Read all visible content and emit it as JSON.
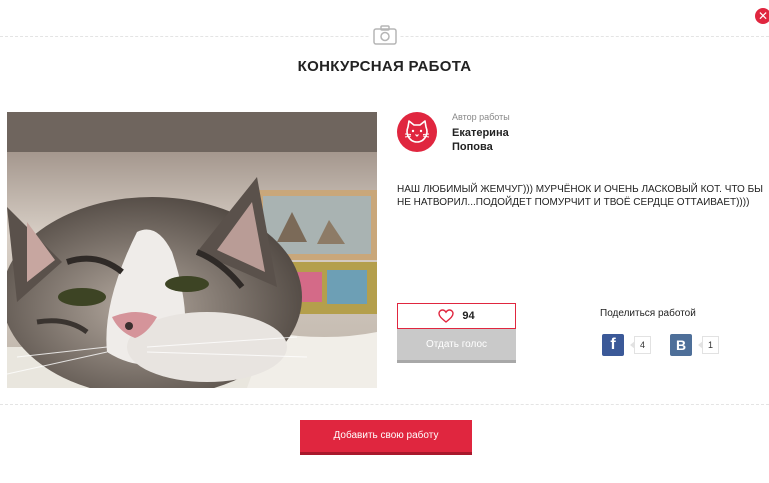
{
  "modal": {
    "title": "КОНКУРСНАЯ РАБОТА",
    "close_symbol": "✕"
  },
  "author": {
    "label": "Автор работы",
    "name": "Екатерина Попова",
    "avatar_icon": "cat-face-icon"
  },
  "entry": {
    "description": "НАШ ЛЮБИМЫЙ ЖЕМЧУГ))) МУРЧЁНОК И ОЧЕНЬ ЛАСКОВЫЙ КОТ. ЧТО БЫ НЕ НАТВОРИЛ...ПОДОЙДЕТ ПОМУРЧИТ И ТВОЁ СЕРДЦЕ ОТТАИВАЕТ))))"
  },
  "votes": {
    "count": "94",
    "vote_label": "Отдать голос"
  },
  "share": {
    "label": "Поделиться работой",
    "facebook_symbol": "f",
    "facebook_count": "4",
    "vk_symbol": "B",
    "vk_count": "1"
  },
  "footer": {
    "add_label": "Добавить свою работу"
  },
  "colors": {
    "accent": "#e0263f",
    "facebook": "#3b5998",
    "vk": "#4e6f99",
    "disabled": "#c9c9c9"
  }
}
